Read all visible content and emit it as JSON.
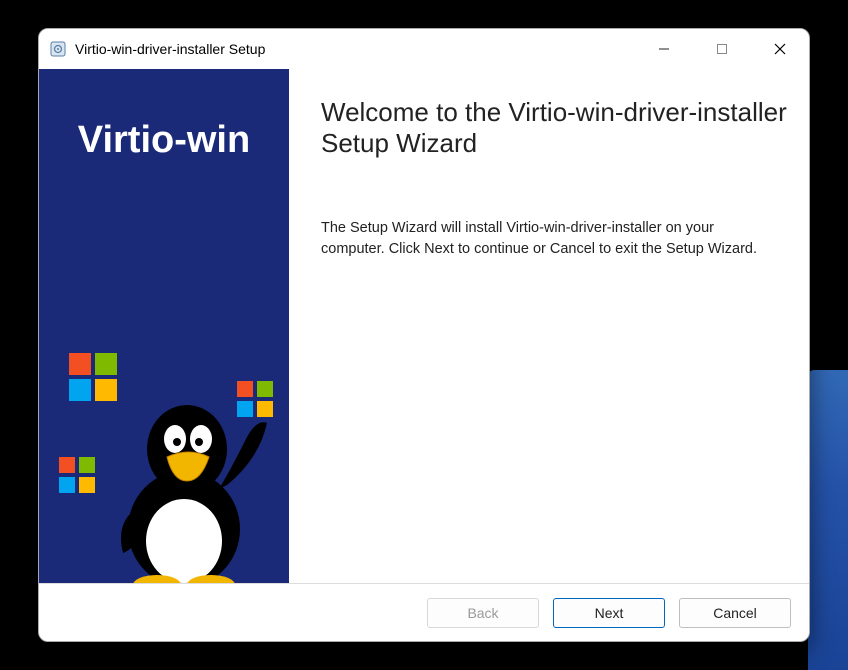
{
  "window": {
    "title": "Virtio-win-driver-installer Setup",
    "icon_name": "msi-installer-icon"
  },
  "controls": {
    "minimize": "minimize-icon",
    "maximize": "maximize-icon",
    "close": "close-icon"
  },
  "sidebar": {
    "brand": "Virtio-win"
  },
  "wizard": {
    "heading": "Welcome to the Virtio-win-driver-installer Setup Wizard",
    "body": "The Setup Wizard will install Virtio-win-driver-installer on your computer. Click Next to continue or Cancel to exit the Setup Wizard."
  },
  "buttons": {
    "back": "Back",
    "next": "Next",
    "cancel": "Cancel"
  }
}
